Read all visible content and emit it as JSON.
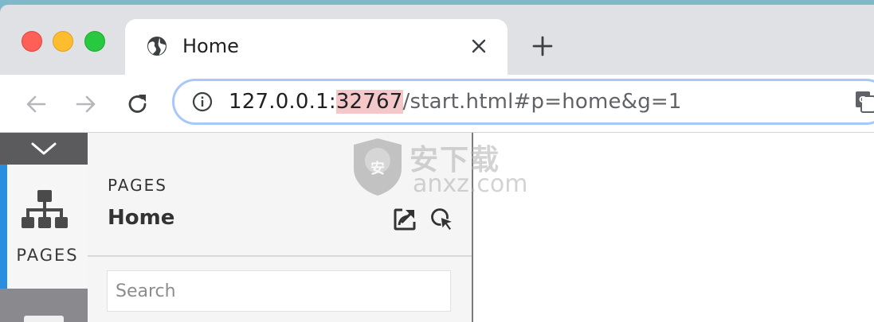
{
  "browser": {
    "tab": {
      "title": "Home",
      "icon": "globe-icon"
    },
    "new_tab_icon": "plus-icon",
    "close_tab_icon": "close-icon",
    "toolbar": {
      "back_icon": "arrow-left-icon",
      "forward_icon": "arrow-right-icon",
      "reload_icon": "reload-icon",
      "info_icon": "info-icon",
      "translate_icon": "translate-icon"
    },
    "address": {
      "host": "127.0.0.1:",
      "port": "32767",
      "path": "/start.html#p=home&g=1"
    }
  },
  "app": {
    "rail": {
      "collapse_icon": "chevron-down-icon",
      "pages_tab_label": "PAGES",
      "pages_tab_icon": "sitemap-icon"
    },
    "panel": {
      "heading": "PAGES",
      "title": "Home",
      "popout_icon": "popout-icon",
      "cursor_icon": "cursor-icon",
      "search_placeholder": "Search"
    }
  },
  "watermark": {
    "text_cn": "安下载",
    "domain": "anxz.com"
  },
  "colors": {
    "accent": "#2a8ee0",
    "port_highlight": "#f4c7c9",
    "omnibox_border": "#a8c7fa",
    "traffic_red": "#fe5f57",
    "traffic_yellow": "#febc2e",
    "traffic_green": "#28c840"
  }
}
